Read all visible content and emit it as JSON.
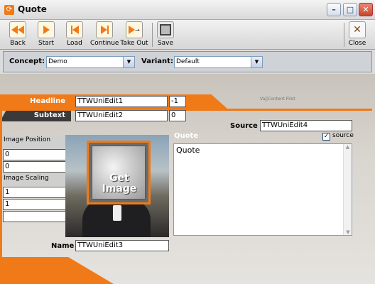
{
  "window": {
    "title": "Quote",
    "app_icon": "⟳"
  },
  "toolbar": {
    "items": [
      {
        "label": "Back",
        "icon": "back-icon"
      },
      {
        "label": "Start",
        "icon": "play-icon"
      },
      {
        "label": "Load",
        "icon": "load-icon"
      },
      {
        "label": "Continue",
        "icon": "continue-icon"
      },
      {
        "label": "Take Out",
        "icon": "takeout-icon"
      },
      {
        "label": "Save",
        "icon": "save-icon"
      },
      {
        "label": "Close",
        "icon": "close-icon"
      }
    ]
  },
  "concept": {
    "label": "Concept:",
    "value": "Demo"
  },
  "variant": {
    "label": "Variant:",
    "value": "Default"
  },
  "editor": {
    "headline_label": "Headline",
    "headline_value": "TTWUniEdit1",
    "headline_num": "-1",
    "subtext_label": "Subtext",
    "subtext_value": "TTWUniEdit2",
    "subtext_num": "0",
    "pilot_text": "Vaj|Content Pilot",
    "source_label": "Source",
    "source_value": "TTWUniEdit4",
    "source_checkbox_label": "source",
    "image_position_label": "Image Position",
    "image_position_x": "0",
    "image_position_y": "0",
    "image_scaling_label": "Image Scaling",
    "image_scaling_x": "1",
    "image_scaling_y": "1",
    "get_image_label": "Get Image",
    "quote_label": "Quote",
    "quote_text": "Quote",
    "name_label": "Name",
    "name_value": "TTWUniEdit3"
  },
  "colors": {
    "accent": "#f07a18",
    "dark_band": "#3a3a3a"
  }
}
